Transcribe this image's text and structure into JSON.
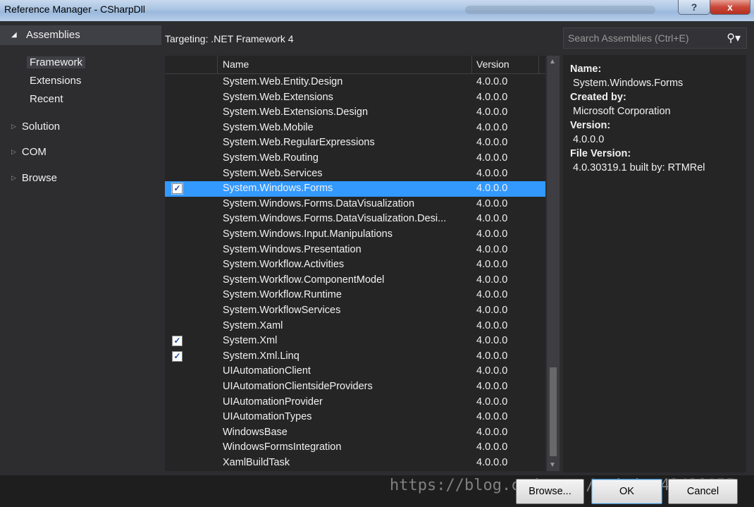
{
  "window": {
    "title": "Reference Manager - CSharpDll",
    "help_label": "?",
    "close_label": "x"
  },
  "sidebar": {
    "header": "Assemblies",
    "subitems": [
      "Framework",
      "Extensions",
      "Recent"
    ],
    "nodes": [
      "Solution",
      "COM",
      "Browse"
    ]
  },
  "targeting": "Targeting: .NET Framework 4",
  "search": {
    "placeholder": "Search Assemblies (Ctrl+E)",
    "icon": "search-icon"
  },
  "columns": {
    "name": "Name",
    "version": "Version"
  },
  "rows": [
    {
      "name": "System.Web.Entity.Design",
      "version": "4.0.0.0",
      "checked": false
    },
    {
      "name": "System.Web.Extensions",
      "version": "4.0.0.0",
      "checked": false
    },
    {
      "name": "System.Web.Extensions.Design",
      "version": "4.0.0.0",
      "checked": false
    },
    {
      "name": "System.Web.Mobile",
      "version": "4.0.0.0",
      "checked": false
    },
    {
      "name": "System.Web.RegularExpressions",
      "version": "4.0.0.0",
      "checked": false
    },
    {
      "name": "System.Web.Routing",
      "version": "4.0.0.0",
      "checked": false
    },
    {
      "name": "System.Web.Services",
      "version": "4.0.0.0",
      "checked": false
    },
    {
      "name": "System.Windows.Forms",
      "version": "4.0.0.0",
      "checked": true,
      "selected": true
    },
    {
      "name": "System.Windows.Forms.DataVisualization",
      "version": "4.0.0.0",
      "checked": false
    },
    {
      "name": "System.Windows.Forms.DataVisualization.Desi...",
      "version": "4.0.0.0",
      "checked": false
    },
    {
      "name": "System.Windows.Input.Manipulations",
      "version": "4.0.0.0",
      "checked": false
    },
    {
      "name": "System.Windows.Presentation",
      "version": "4.0.0.0",
      "checked": false
    },
    {
      "name": "System.Workflow.Activities",
      "version": "4.0.0.0",
      "checked": false
    },
    {
      "name": "System.Workflow.ComponentModel",
      "version": "4.0.0.0",
      "checked": false
    },
    {
      "name": "System.Workflow.Runtime",
      "version": "4.0.0.0",
      "checked": false
    },
    {
      "name": "System.WorkflowServices",
      "version": "4.0.0.0",
      "checked": false
    },
    {
      "name": "System.Xaml",
      "version": "4.0.0.0",
      "checked": false
    },
    {
      "name": "System.Xml",
      "version": "4.0.0.0",
      "checked": true
    },
    {
      "name": "System.Xml.Linq",
      "version": "4.0.0.0",
      "checked": true
    },
    {
      "name": "UIAutomationClient",
      "version": "4.0.0.0",
      "checked": false
    },
    {
      "name": "UIAutomationClientsideProviders",
      "version": "4.0.0.0",
      "checked": false
    },
    {
      "name": "UIAutomationProvider",
      "version": "4.0.0.0",
      "checked": false
    },
    {
      "name": "UIAutomationTypes",
      "version": "4.0.0.0",
      "checked": false
    },
    {
      "name": "WindowsBase",
      "version": "4.0.0.0",
      "checked": false
    },
    {
      "name": "WindowsFormsIntegration",
      "version": "4.0.0.0",
      "checked": false
    },
    {
      "name": "XamlBuildTask",
      "version": "4.0.0.0",
      "checked": false
    }
  ],
  "details": {
    "name_label": "Name:",
    "name_value": "System.Windows.Forms",
    "created_label": "Created by:",
    "created_value": "Microsoft Corporation",
    "version_label": "Version:",
    "version_value": "4.0.0.0",
    "file_version_label": "File Version:",
    "file_version_value": "4.0.30319.1 built by: RTMRel"
  },
  "buttons": {
    "browse": "Browse...",
    "ok": "OK",
    "cancel": "Cancel"
  },
  "watermark": "https://blog.csdn.net/weixin_42420155",
  "colors": {
    "selection": "#3399ff",
    "background": "#2d2d30",
    "list_bg": "#252526"
  }
}
